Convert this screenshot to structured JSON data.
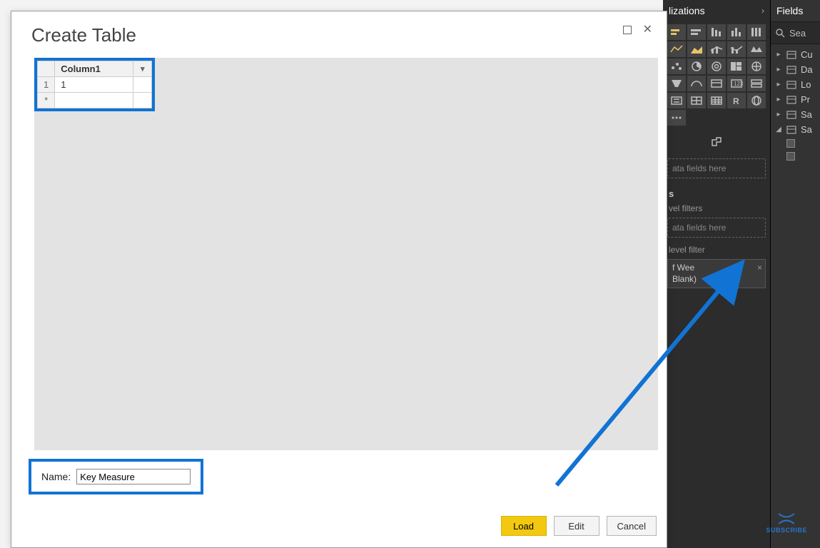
{
  "dialog": {
    "title": "Create Table",
    "table": {
      "column_header": "Column1",
      "row1_num": "1",
      "row1_val": "1",
      "newrow_marker": "*",
      "expand_marker": "▾"
    },
    "name_label": "Name:",
    "name_value": "Key Measure",
    "buttons": {
      "load": "Load",
      "edit": "Edit",
      "cancel": "Cancel"
    }
  },
  "viz": {
    "header": "lizations",
    "drop_values": "ata fields here",
    "section_filters": "s",
    "level_filters": "vel filters",
    "drop_filters": "ata fields here",
    "level_filter2": "level filter",
    "chip_line1": "f Wee",
    "chip_line2": "Blank)"
  },
  "fields": {
    "header": "Fields",
    "search": "Sea",
    "items": [
      "Cu",
      "Da",
      "Lo",
      "Pr",
      "Sa"
    ],
    "expanded": "Sa"
  },
  "subscribe": "SUBSCRIBE"
}
